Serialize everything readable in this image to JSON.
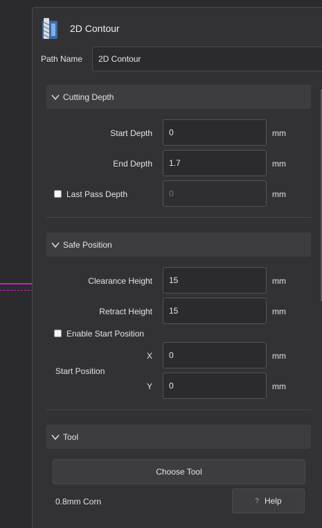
{
  "panel": {
    "title": "2D Contour",
    "path_name_label": "Path Name",
    "path_name_value": "2D Contour"
  },
  "cutting_depth": {
    "title": "Cutting Depth",
    "start_depth_label": "Start Depth",
    "start_depth_value": "0",
    "end_depth_label": "End Depth",
    "end_depth_value": "1.7",
    "last_pass_label": "Last Pass Depth",
    "last_pass_checked": false,
    "last_pass_placeholder": "0",
    "unit": "mm"
  },
  "safe_position": {
    "title": "Safe Position",
    "clearance_label": "Clearance Height",
    "clearance_value": "15",
    "retract_label": "Retract Height",
    "retract_value": "15",
    "enable_start_label": "Enable Start Position",
    "enable_start_checked": false,
    "start_position_label": "Start Position",
    "x_label": "X",
    "x_value": "0",
    "y_label": "Y",
    "y_value": "0",
    "unit": "mm"
  },
  "tool": {
    "title": "Tool",
    "choose_label": "Choose Tool",
    "tool_name": "0.8mm Corn",
    "help_icon": "?",
    "help_label": "Help"
  },
  "colors": {
    "background": "#2b2b2e",
    "panel": "#323235",
    "section_header": "#3d3d41",
    "toolpath": "#c81fd0"
  },
  "icons": {
    "app": "end-mill-icon",
    "chevron": "chevron-down-icon"
  }
}
